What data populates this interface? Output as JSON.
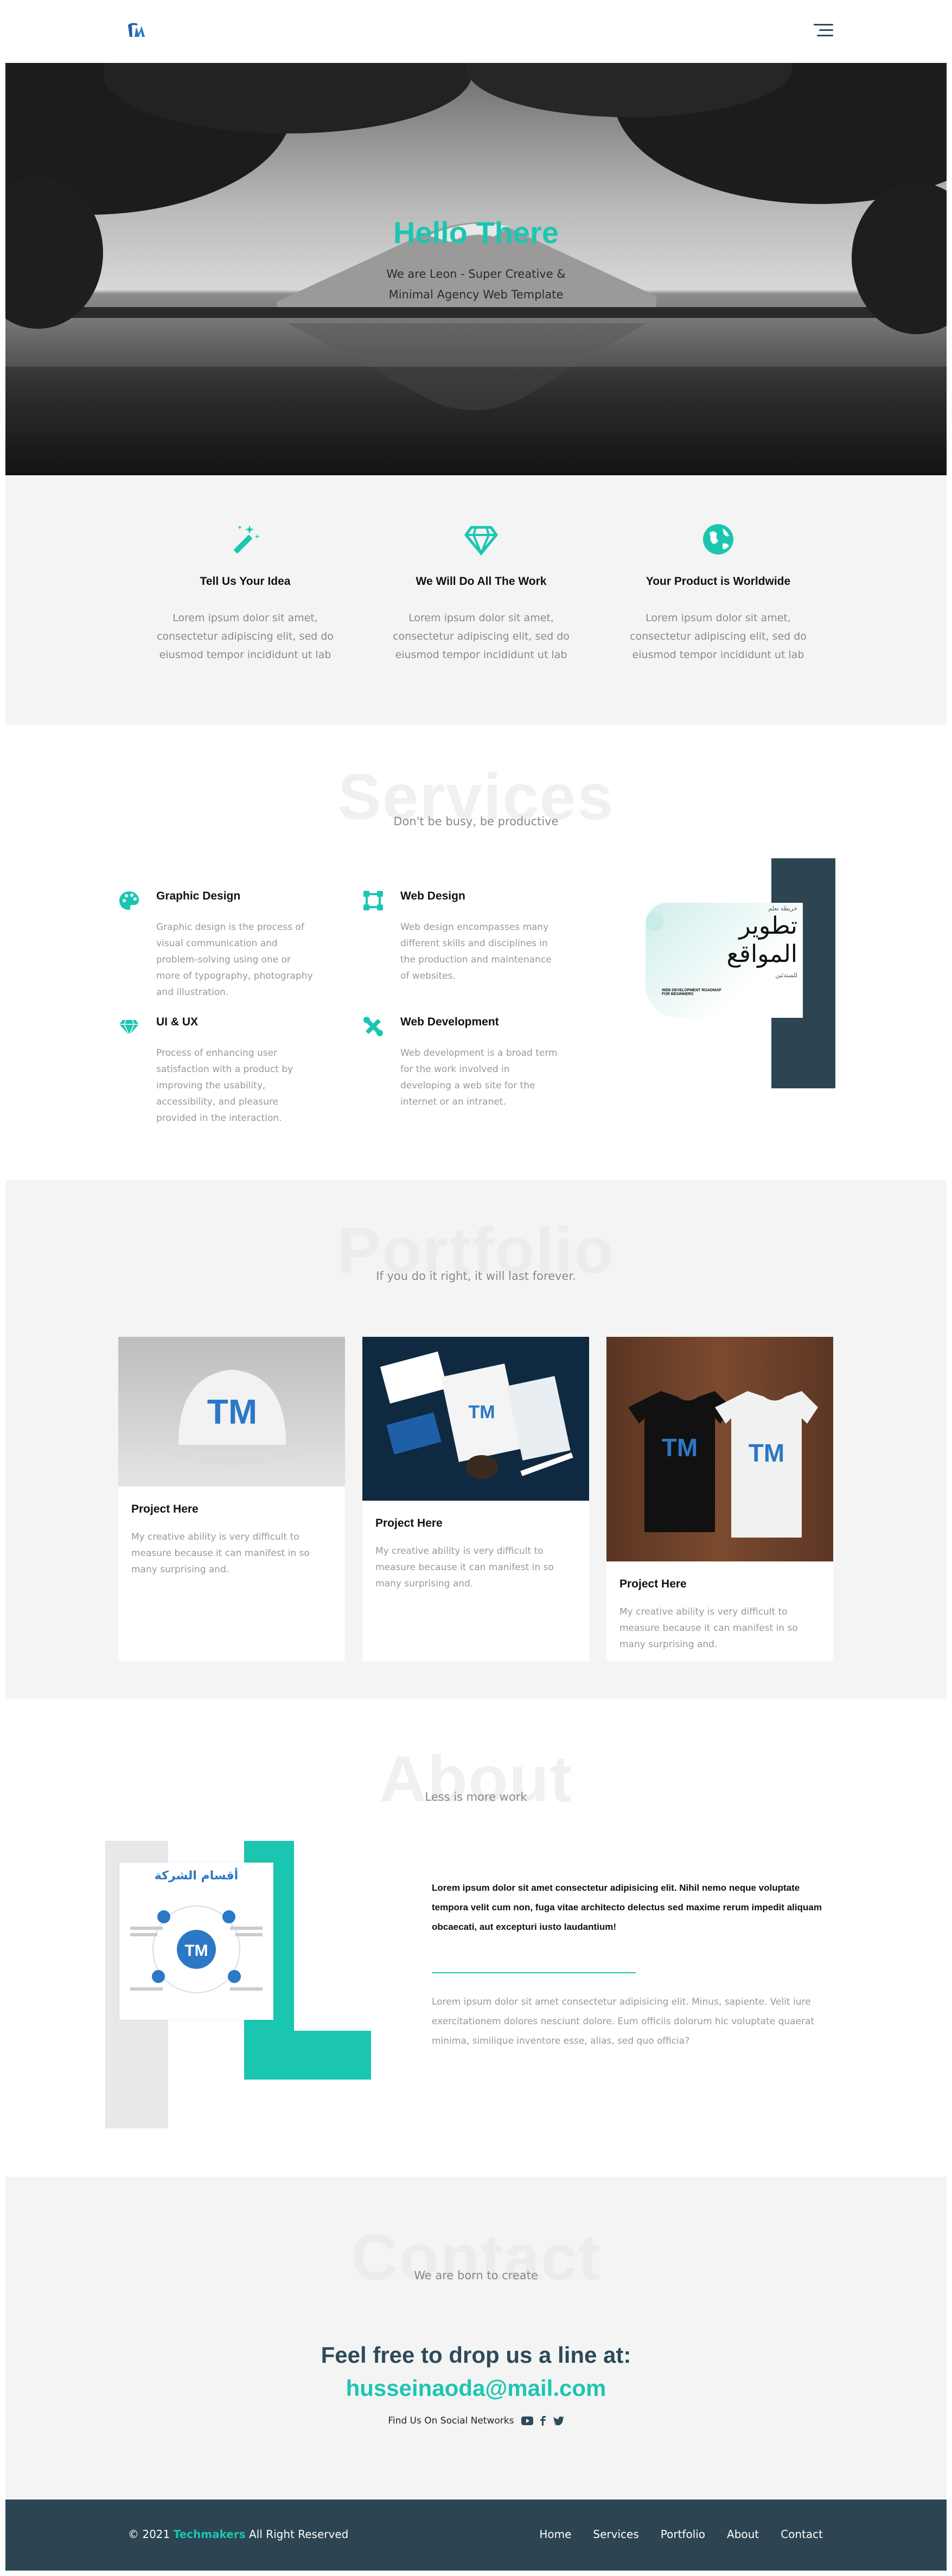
{
  "colors": {
    "accent": "#1bc6b1",
    "dark": "#2d4552",
    "navy": "#2d4a5a",
    "gray_bg": "#f4f4f4"
  },
  "header": {
    "logo_icon": "tm-logo-icon",
    "menu_icon": "hamburger-icon"
  },
  "hero": {
    "title": "Hello There",
    "subtitle_line1": "We are Leon - Super Creative &",
    "subtitle_line2": "Minimal Agency Web Template"
  },
  "features": [
    {
      "icon": "magic-wand-icon",
      "title": "Tell Us Your Idea",
      "text_l1": "Lorem ipsum dolor sit amet,",
      "text_l2": "consectetur adipiscing elit, sed do",
      "text_l3": "eiusmod tempor incididunt ut lab"
    },
    {
      "icon": "diamond-icon",
      "title": "We Will Do All The Work",
      "text_l1": "Lorem ipsum dolor sit amet,",
      "text_l2": "consectetur adipiscing elit, sed do",
      "text_l3": "eiusmod tempor incididunt ut lab"
    },
    {
      "icon": "globe-icon",
      "title": "Your Product is Worldwide",
      "text_l1": "Lorem ipsum dolor sit amet,",
      "text_l2": "consectetur adipiscing elit, sed do",
      "text_l3": "eiusmod tempor incididunt ut lab"
    }
  ],
  "services": {
    "bg_title": "Services",
    "subtitle": "Don't be busy, be productive",
    "items": [
      {
        "icon": "palette-icon",
        "title": "Graphic Design",
        "text": "Graphic design is the process of visual communication and problem-solving using one or more of typography, photography and illustration."
      },
      {
        "icon": "vector-square-icon",
        "title": "Web Design",
        "text": "Web design encompasses many different skills and disciplines in the production and maintenance of websites."
      },
      {
        "icon": "gem-icon",
        "title": "UI & UX",
        "text": "Process of enhancing user satisfaction with a product by improving the usability, accessibility, and pleasure provided in the interaction."
      },
      {
        "icon": "tools-icon",
        "title": "Web Development",
        "text": "Web development is a broad term for the work involved in developing a web site for the internet or an intranet."
      }
    ],
    "image": {
      "small_label": "خريطة تعلم",
      "title_l1": "تطوير",
      "title_l2": "المواقع",
      "tag": "للمبتدئين",
      "caption_l1": "WEB DEVELOPMENT ROADMAP",
      "caption_l2": "FOR BEGINNERS"
    }
  },
  "portfolio": {
    "bg_title": "Portfolio",
    "subtitle": "If you do it right, it will last forever.",
    "items": [
      {
        "title": "Project Here",
        "text": "My creative ability is very difficult to measure because it can manifest in so many surprising and."
      },
      {
        "title": "Project Here",
        "text": "My creative ability is very difficult to measure because it can manifest in so many surprising and."
      },
      {
        "title": "Project Here",
        "text": "My creative ability is very difficult to measure because it can manifest in so many surprising and."
      }
    ]
  },
  "about": {
    "bg_title": "About",
    "subtitle": "Less is more work",
    "image_title": "أقسام الشركة",
    "bold_text": "Lorem ipsum dolor sit amet consectetur adipisicing elit. Nihil nemo neque voluptate tempora velit cum non, fuga vitae architecto delectus sed maxime rerum impedit aliquam obcaecati, aut excepturi iusto laudantium!",
    "text": "Lorem ipsum dolor sit amet consectetur adipisicing elit. Minus, sapiente. Velit iure exercitationem dolores nesciunt dolore. Eum officiis dolorum hic voluptate quaerat minima, similique inventore esse, alias, sed quo officia?"
  },
  "contact": {
    "bg_title": "Contact",
    "subtitle": "We are born to create",
    "headline": "Feel free to drop us a line at:",
    "email": "husseinaoda@mail.com",
    "social_label": "Find Us On Social Networks",
    "social_icons": [
      "youtube-icon",
      "facebook-icon",
      "twitter-icon"
    ]
  },
  "footer": {
    "copyright_prefix": "© 2021 ",
    "brand": "Techmakers",
    "copyright_suffix": " All Right Reserved",
    "nav": [
      "Home",
      "Services",
      "Portfolio",
      "About",
      "Contact"
    ]
  }
}
